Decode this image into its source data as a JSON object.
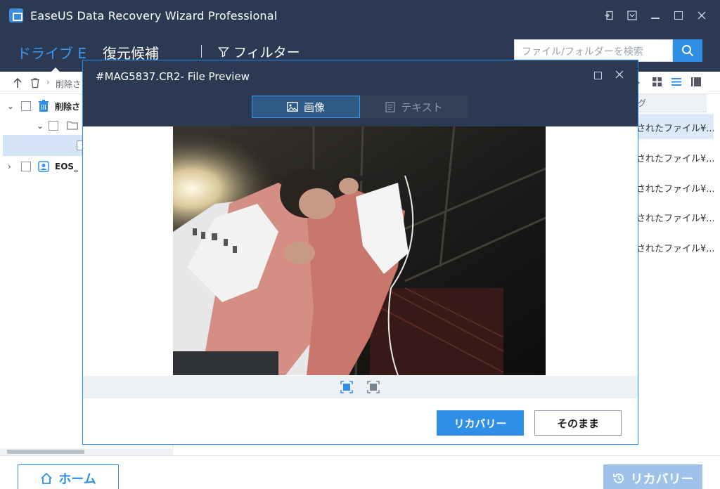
{
  "app": {
    "title": "EaseUS Data Recovery Wizard Professional"
  },
  "nav": {
    "drive_tab": "ドライブ E",
    "candidates_tab": "復元候補",
    "filter_label": "フィルター",
    "search_placeholder": "ファイル/フォルダーを検索"
  },
  "toolbar": {
    "path_text": "削除さ"
  },
  "tree": {
    "items": [
      {
        "label": "削除さ"
      },
      {
        "label": ""
      },
      {
        "label": ""
      },
      {
        "label": "EOS_"
      }
    ]
  },
  "list": {
    "header": "グ",
    "rows": [
      "されたファイル¥...",
      "されたファイル¥...",
      "されたファイル¥...",
      "されたファイル¥...",
      "されたファイル¥..."
    ]
  },
  "modal": {
    "title": "#MAG5837.CR2- File Preview",
    "tab_image": "画像",
    "tab_text": "テキスト",
    "recover_button": "リカバリー",
    "keep_button": "そのまま"
  },
  "bottom": {
    "home_button": "ホーム",
    "recover_button": "リカバリー"
  },
  "colors": {
    "accent": "#2f8fe6",
    "titlebar": "#2b3a52"
  }
}
